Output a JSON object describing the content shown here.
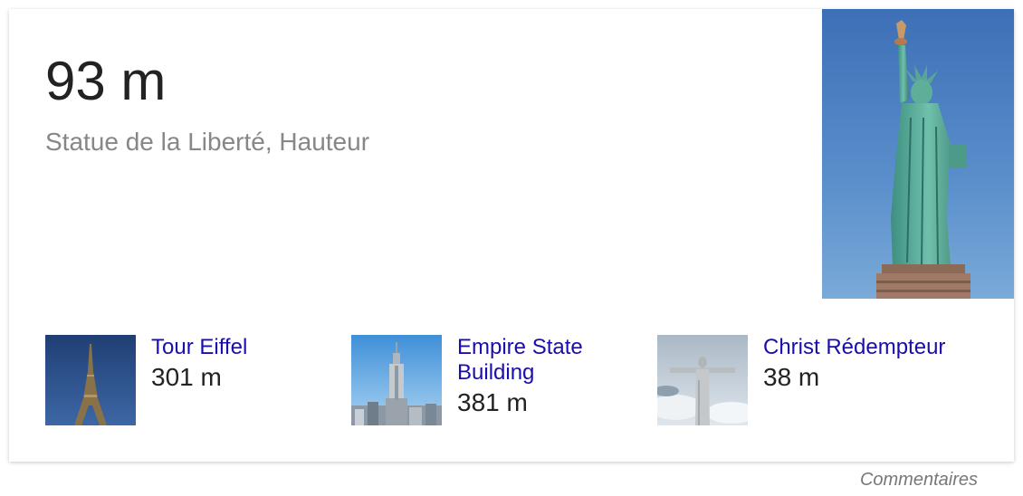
{
  "answer": {
    "value": "93 m",
    "subtitle": "Statue de la Liberté, Hauteur",
    "image_icon": "statue-of-liberty-image"
  },
  "related": [
    {
      "name": "Tour Eiffel",
      "value": "301 m",
      "icon": "eiffel-tower-image"
    },
    {
      "name": "Empire State Building",
      "value": "381 m",
      "icon": "empire-state-building-image"
    },
    {
      "name": "Christ Rédempteur",
      "value": "38 m",
      "icon": "christ-redeemer-image"
    }
  ],
  "feedback_label": "Commentaires",
  "colors": {
    "link": "#1a0dab",
    "value_text": "#222222",
    "subtitle_text": "#878787",
    "feedback_text": "#777777"
  }
}
